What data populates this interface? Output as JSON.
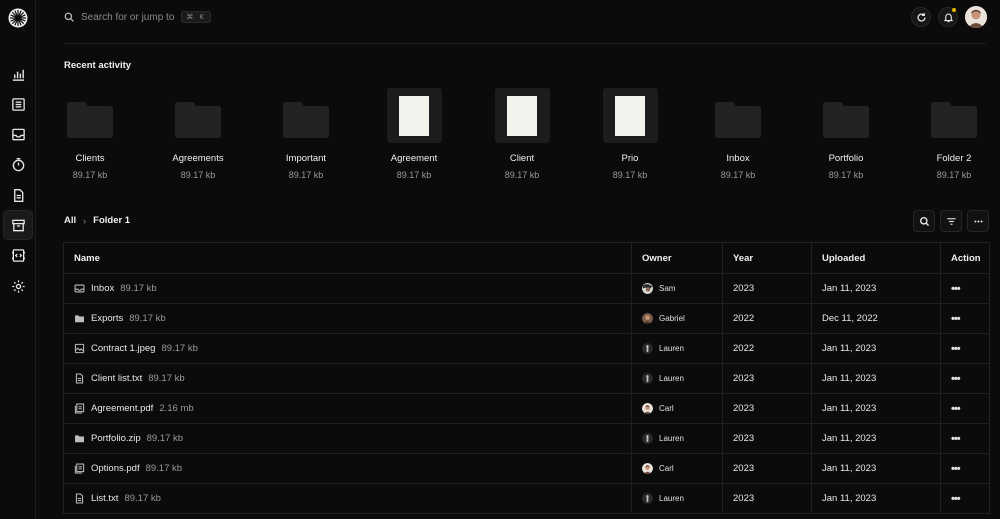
{
  "search": {
    "placeholder": "Search for or jump to",
    "shortcut": "⌘ K"
  },
  "sidebar": {
    "items": [
      {
        "name": "analytics-icon"
      },
      {
        "name": "list-icon"
      },
      {
        "name": "inbox-icon"
      },
      {
        "name": "timer-icon"
      },
      {
        "name": "document-icon"
      },
      {
        "name": "archive-icon",
        "active": true
      },
      {
        "name": "code-icon"
      },
      {
        "name": "settings-icon"
      }
    ]
  },
  "recent": {
    "title": "Recent activity",
    "items": [
      {
        "name": "Clients",
        "size": "89.17 kb",
        "kind": "folder"
      },
      {
        "name": "Agreements",
        "size": "89.17 kb",
        "kind": "folder"
      },
      {
        "name": "Important",
        "size": "89.17 kb",
        "kind": "folder"
      },
      {
        "name": "Agreement",
        "size": "89.17 kb",
        "kind": "doc"
      },
      {
        "name": "Client",
        "size": "89.17 kb",
        "kind": "doc"
      },
      {
        "name": "Prio",
        "size": "89.17 kb",
        "kind": "doc"
      },
      {
        "name": "Inbox",
        "size": "89.17 kb",
        "kind": "folder"
      },
      {
        "name": "Portfolio",
        "size": "89.17 kb",
        "kind": "folder"
      },
      {
        "name": "Folder 2",
        "size": "89.17 kb",
        "kind": "folder"
      }
    ]
  },
  "breadcrumb": {
    "root": "All",
    "separator": "›",
    "current": "Folder 1"
  },
  "table": {
    "columns": {
      "name": "Name",
      "owner": "Owner",
      "year": "Year",
      "uploaded": "Uploaded",
      "action": "Action"
    },
    "action_label": "•••",
    "rows": [
      {
        "name": "Inbox",
        "size": "89.17 kb",
        "icon": "inbox-icon",
        "owner": "Sam",
        "year": "2023",
        "uploaded": "Jan 11, 2023"
      },
      {
        "name": "Exports",
        "size": "89.17 kb",
        "icon": "folder-icon",
        "owner": "Gabriel",
        "year": "2022",
        "uploaded": "Dec 11, 2022"
      },
      {
        "name": "Contract 1.jpeg",
        "size": "89.17 kb",
        "icon": "image-icon",
        "owner": "Lauren",
        "year": "2022",
        "uploaded": "Jan 11, 2023"
      },
      {
        "name": "Client list.txt",
        "size": "89.17 kb",
        "icon": "text-file-icon",
        "owner": "Lauren",
        "year": "2023",
        "uploaded": "Jan 11, 2023"
      },
      {
        "name": "Agreement.pdf",
        "size": "2.16 mb",
        "icon": "pdf-file-icon",
        "owner": "Carl",
        "year": "2023",
        "uploaded": "Jan 11, 2023"
      },
      {
        "name": "Portfolio.zip",
        "size": "89.17 kb",
        "icon": "folder-icon",
        "owner": "Lauren",
        "year": "2023",
        "uploaded": "Jan 11, 2023"
      },
      {
        "name": "Options.pdf",
        "size": "89.17 kb",
        "icon": "pdf-file-icon",
        "owner": "Carl",
        "year": "2023",
        "uploaded": "Jan 11, 2023"
      },
      {
        "name": "List.txt",
        "size": "89.17 kb",
        "icon": "text-file-icon",
        "owner": "Lauren",
        "year": "2023",
        "uploaded": "Jan 11, 2023"
      }
    ]
  },
  "colors": {
    "background": "#0b0b0b",
    "notification": "#e6b800",
    "doc_page": "#f2f2ec"
  }
}
